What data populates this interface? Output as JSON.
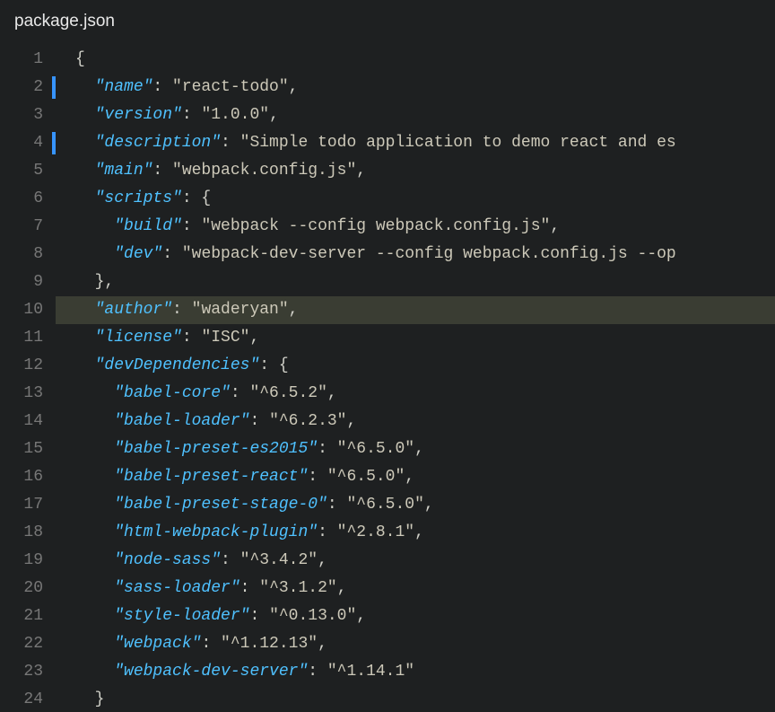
{
  "tab": {
    "title": "package.json"
  },
  "editor": {
    "highlighted_line": 10,
    "diff_markers": [
      2,
      4
    ],
    "lines": [
      {
        "num": 1,
        "tokens": [
          {
            "cls": "punc",
            "t": "{"
          }
        ]
      },
      {
        "num": 2,
        "tokens": [
          {
            "cls": "punc",
            "t": "  "
          },
          {
            "cls": "key",
            "t": "\"name\""
          },
          {
            "cls": "punc",
            "t": ": "
          },
          {
            "cls": "str",
            "t": "\"react-todo\""
          },
          {
            "cls": "punc",
            "t": ","
          }
        ]
      },
      {
        "num": 3,
        "tokens": [
          {
            "cls": "punc",
            "t": "  "
          },
          {
            "cls": "key",
            "t": "\"version\""
          },
          {
            "cls": "punc",
            "t": ": "
          },
          {
            "cls": "str",
            "t": "\"1.0.0\""
          },
          {
            "cls": "punc",
            "t": ","
          }
        ]
      },
      {
        "num": 4,
        "tokens": [
          {
            "cls": "punc",
            "t": "  "
          },
          {
            "cls": "key",
            "t": "\"description\""
          },
          {
            "cls": "punc",
            "t": ": "
          },
          {
            "cls": "str",
            "t": "\"Simple todo application to demo react and es"
          }
        ]
      },
      {
        "num": 5,
        "tokens": [
          {
            "cls": "punc",
            "t": "  "
          },
          {
            "cls": "key",
            "t": "\"main\""
          },
          {
            "cls": "punc",
            "t": ": "
          },
          {
            "cls": "str",
            "t": "\"webpack.config.js\""
          },
          {
            "cls": "punc",
            "t": ","
          }
        ]
      },
      {
        "num": 6,
        "tokens": [
          {
            "cls": "punc",
            "t": "  "
          },
          {
            "cls": "key",
            "t": "\"scripts\""
          },
          {
            "cls": "punc",
            "t": ": {"
          }
        ]
      },
      {
        "num": 7,
        "tokens": [
          {
            "cls": "punc",
            "t": "    "
          },
          {
            "cls": "key",
            "t": "\"build\""
          },
          {
            "cls": "punc",
            "t": ": "
          },
          {
            "cls": "str",
            "t": "\"webpack --config webpack.config.js\""
          },
          {
            "cls": "punc",
            "t": ","
          }
        ]
      },
      {
        "num": 8,
        "tokens": [
          {
            "cls": "punc",
            "t": "    "
          },
          {
            "cls": "key",
            "t": "\"dev\""
          },
          {
            "cls": "punc",
            "t": ": "
          },
          {
            "cls": "str",
            "t": "\"webpack-dev-server --config webpack.config.js --op"
          }
        ]
      },
      {
        "num": 9,
        "tokens": [
          {
            "cls": "punc",
            "t": "  },"
          }
        ]
      },
      {
        "num": 10,
        "tokens": [
          {
            "cls": "punc",
            "t": "  "
          },
          {
            "cls": "key",
            "t": "\"author\""
          },
          {
            "cls": "punc",
            "t": ": "
          },
          {
            "cls": "str",
            "t": "\"waderyan\""
          },
          {
            "cls": "punc",
            "t": ","
          }
        ]
      },
      {
        "num": 11,
        "tokens": [
          {
            "cls": "punc",
            "t": "  "
          },
          {
            "cls": "key",
            "t": "\"license\""
          },
          {
            "cls": "punc",
            "t": ": "
          },
          {
            "cls": "str",
            "t": "\"ISC\""
          },
          {
            "cls": "punc",
            "t": ","
          }
        ]
      },
      {
        "num": 12,
        "tokens": [
          {
            "cls": "punc",
            "t": "  "
          },
          {
            "cls": "key",
            "t": "\"devDependencies\""
          },
          {
            "cls": "punc",
            "t": ": {"
          }
        ]
      },
      {
        "num": 13,
        "tokens": [
          {
            "cls": "punc",
            "t": "    "
          },
          {
            "cls": "key",
            "t": "\"babel-core\""
          },
          {
            "cls": "punc",
            "t": ": "
          },
          {
            "cls": "str",
            "t": "\"^6.5.2\""
          },
          {
            "cls": "punc",
            "t": ","
          }
        ]
      },
      {
        "num": 14,
        "tokens": [
          {
            "cls": "punc",
            "t": "    "
          },
          {
            "cls": "key",
            "t": "\"babel-loader\""
          },
          {
            "cls": "punc",
            "t": ": "
          },
          {
            "cls": "str",
            "t": "\"^6.2.3\""
          },
          {
            "cls": "punc",
            "t": ","
          }
        ]
      },
      {
        "num": 15,
        "tokens": [
          {
            "cls": "punc",
            "t": "    "
          },
          {
            "cls": "key",
            "t": "\"babel-preset-es2015\""
          },
          {
            "cls": "punc",
            "t": ": "
          },
          {
            "cls": "str",
            "t": "\"^6.5.0\""
          },
          {
            "cls": "punc",
            "t": ","
          }
        ]
      },
      {
        "num": 16,
        "tokens": [
          {
            "cls": "punc",
            "t": "    "
          },
          {
            "cls": "key",
            "t": "\"babel-preset-react\""
          },
          {
            "cls": "punc",
            "t": ": "
          },
          {
            "cls": "str",
            "t": "\"^6.5.0\""
          },
          {
            "cls": "punc",
            "t": ","
          }
        ]
      },
      {
        "num": 17,
        "tokens": [
          {
            "cls": "punc",
            "t": "    "
          },
          {
            "cls": "key",
            "t": "\"babel-preset-stage-0\""
          },
          {
            "cls": "punc",
            "t": ": "
          },
          {
            "cls": "str",
            "t": "\"^6.5.0\""
          },
          {
            "cls": "punc",
            "t": ","
          }
        ]
      },
      {
        "num": 18,
        "tokens": [
          {
            "cls": "punc",
            "t": "    "
          },
          {
            "cls": "key",
            "t": "\"html-webpack-plugin\""
          },
          {
            "cls": "punc",
            "t": ": "
          },
          {
            "cls": "str",
            "t": "\"^2.8.1\""
          },
          {
            "cls": "punc",
            "t": ","
          }
        ]
      },
      {
        "num": 19,
        "tokens": [
          {
            "cls": "punc",
            "t": "    "
          },
          {
            "cls": "key",
            "t": "\"node-sass\""
          },
          {
            "cls": "punc",
            "t": ": "
          },
          {
            "cls": "str",
            "t": "\"^3.4.2\""
          },
          {
            "cls": "punc",
            "t": ","
          }
        ]
      },
      {
        "num": 20,
        "tokens": [
          {
            "cls": "punc",
            "t": "    "
          },
          {
            "cls": "key",
            "t": "\"sass-loader\""
          },
          {
            "cls": "punc",
            "t": ": "
          },
          {
            "cls": "str",
            "t": "\"^3.1.2\""
          },
          {
            "cls": "punc",
            "t": ","
          }
        ]
      },
      {
        "num": 21,
        "tokens": [
          {
            "cls": "punc",
            "t": "    "
          },
          {
            "cls": "key",
            "t": "\"style-loader\""
          },
          {
            "cls": "punc",
            "t": ": "
          },
          {
            "cls": "str",
            "t": "\"^0.13.0\""
          },
          {
            "cls": "punc",
            "t": ","
          }
        ]
      },
      {
        "num": 22,
        "tokens": [
          {
            "cls": "punc",
            "t": "    "
          },
          {
            "cls": "key",
            "t": "\"webpack\""
          },
          {
            "cls": "punc",
            "t": ": "
          },
          {
            "cls": "str",
            "t": "\"^1.12.13\""
          },
          {
            "cls": "punc",
            "t": ","
          }
        ]
      },
      {
        "num": 23,
        "tokens": [
          {
            "cls": "punc",
            "t": "    "
          },
          {
            "cls": "key",
            "t": "\"webpack-dev-server\""
          },
          {
            "cls": "punc",
            "t": ": "
          },
          {
            "cls": "str",
            "t": "\"^1.14.1\""
          }
        ]
      },
      {
        "num": 24,
        "tokens": [
          {
            "cls": "punc",
            "t": "  }"
          }
        ]
      }
    ]
  }
}
